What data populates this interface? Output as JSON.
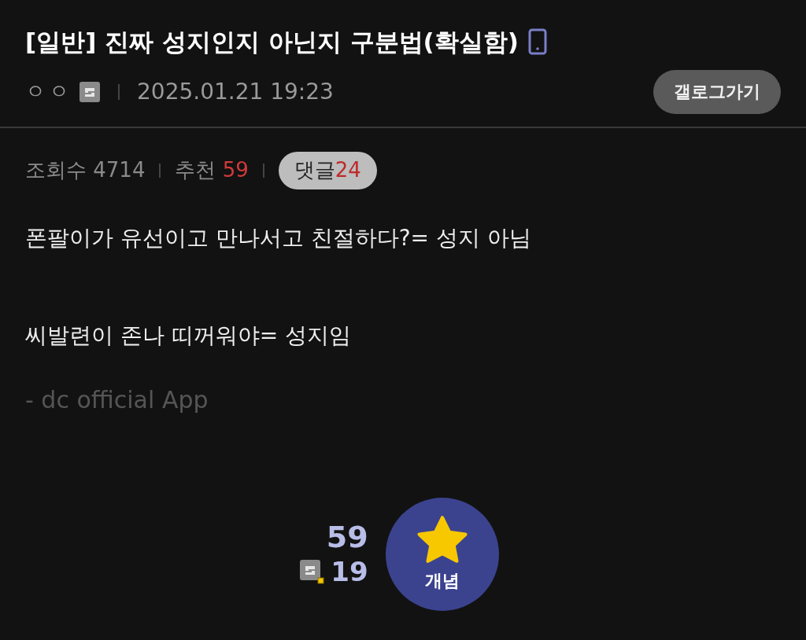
{
  "post": {
    "title": "[일반] 진짜 성지인지 아닌지 구분법(확실함)",
    "author": "ㅇㅇ",
    "datetime": "2025.01.21 19:23",
    "gallery_button": "갤로그가기"
  },
  "stats": {
    "views_label": "조회수",
    "views": "4714",
    "recommend_label": "추천",
    "recommend": "59",
    "comments_label": "댓글",
    "comments": "24"
  },
  "body": [
    {
      "kind": "line",
      "text": "폰팔이가 유선이고 만나서고 친절하다?= 성지 아님"
    },
    {
      "kind": "gap"
    },
    {
      "kind": "line",
      "text": "씨발련이 존나 띠꺼워야= 성지임"
    },
    {
      "kind": "signature",
      "text": "- dc official App"
    }
  ],
  "vote": {
    "count": "59",
    "fixed_count": "19",
    "button": "개념"
  }
}
